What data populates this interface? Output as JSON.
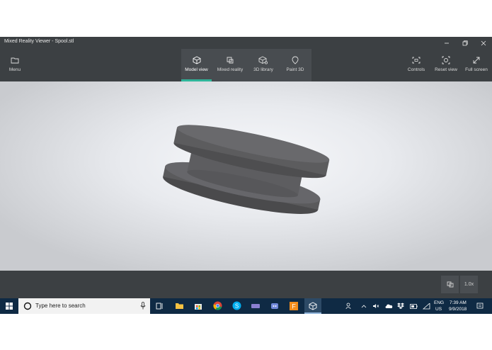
{
  "window": {
    "title": "Mixed Reality Viewer - Spool.stl"
  },
  "toolbar": {
    "menu_label": "Menu",
    "tabs": [
      {
        "label": "Model view",
        "icon": "cube-icon",
        "active": true
      },
      {
        "label": "Mixed reality",
        "icon": "mixed-reality-icon",
        "active": false
      },
      {
        "label": "3D library",
        "icon": "3d-library-icon",
        "active": false
      },
      {
        "label": "Paint 3D",
        "icon": "paint-3d-icon",
        "active": false
      }
    ],
    "controls_label": "Controls",
    "reset_label": "Reset view",
    "fullscreen_label": "Full screen"
  },
  "bottombar": {
    "zoom": "1.0x"
  },
  "taskbar": {
    "search_placeholder": "Type here to search",
    "language": "ENG",
    "region": "US",
    "time": "7:39 AM",
    "date": "9/9/2018"
  },
  "colors": {
    "accent": "#2fb59a",
    "chrome": "#3c4043",
    "taskbar": "#0f2a44",
    "model": "#58585a"
  }
}
